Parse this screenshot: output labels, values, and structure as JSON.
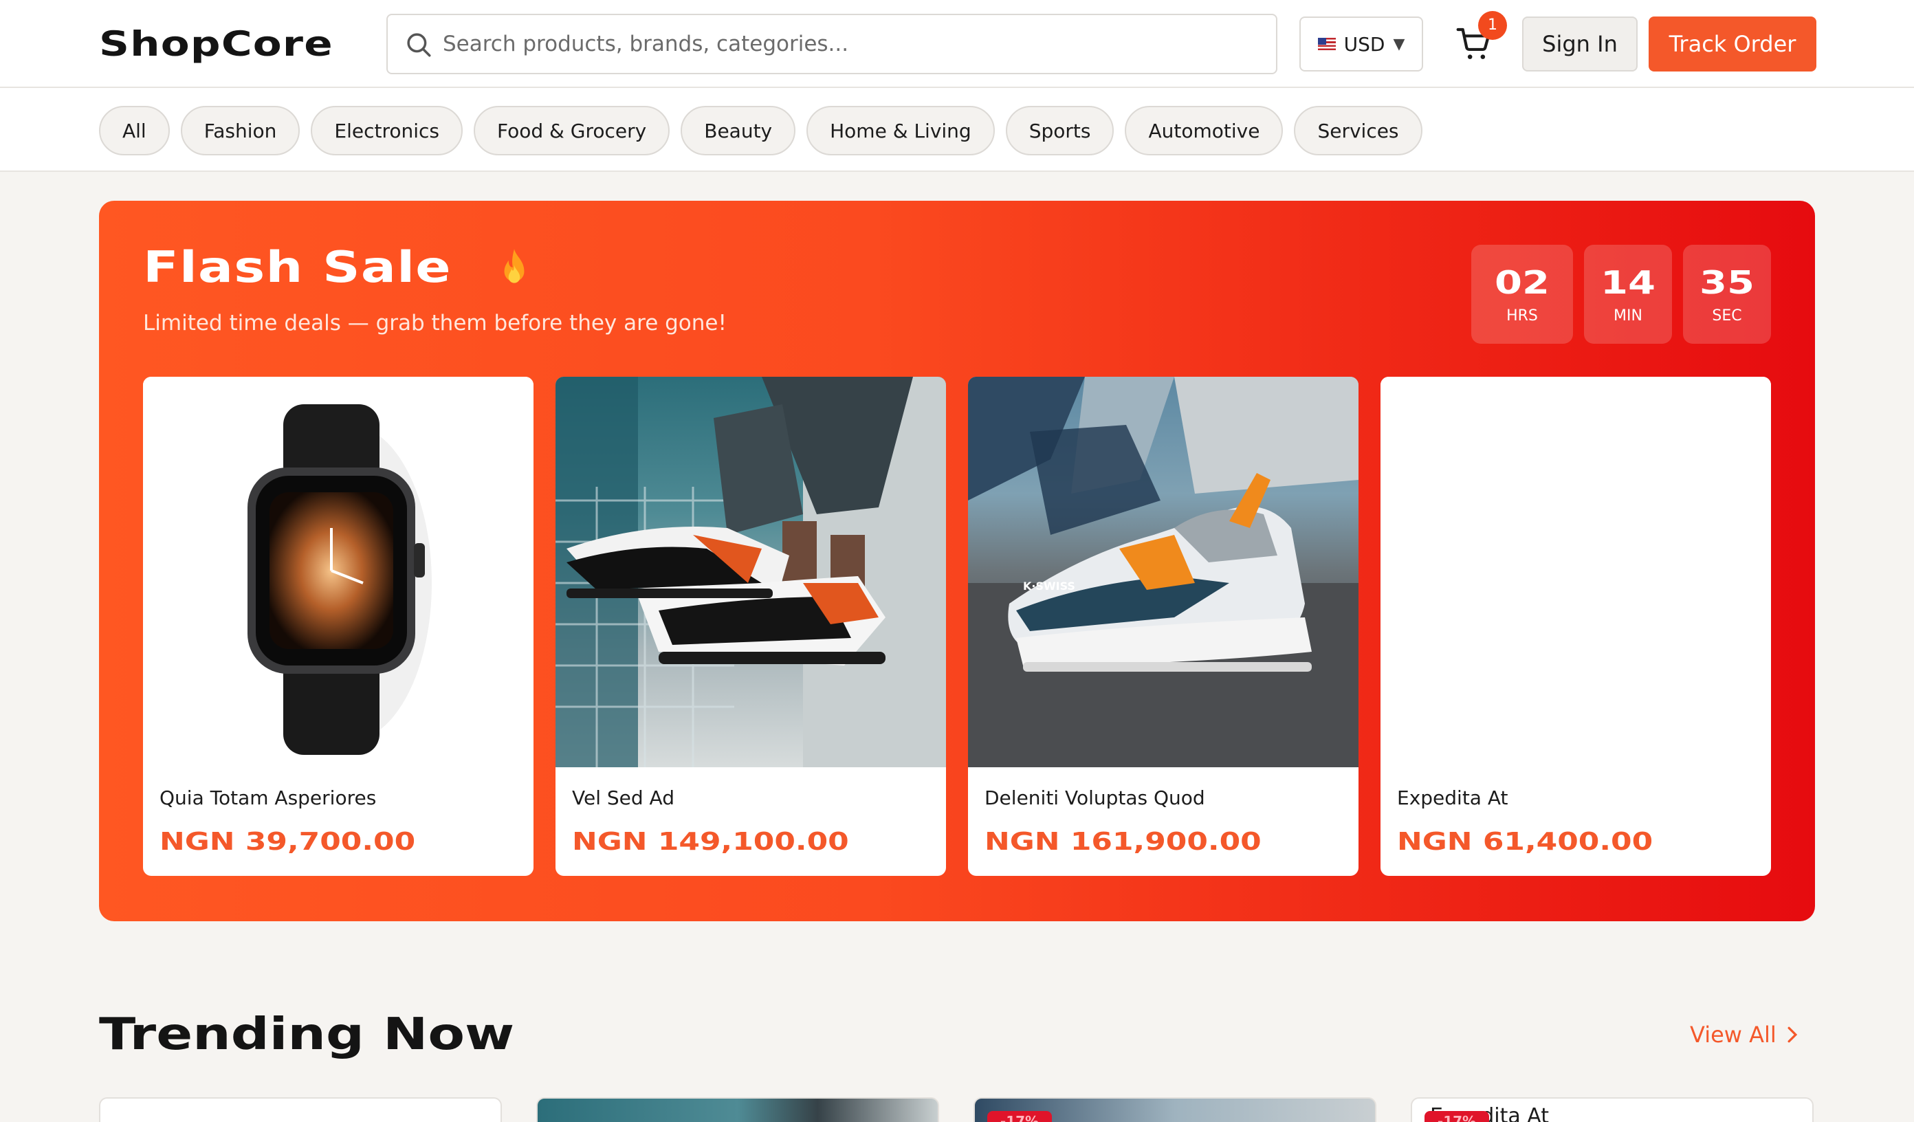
{
  "header": {
    "logo": "ShopCore",
    "search_placeholder": "Search products, brands, categories...",
    "currency": "USD",
    "currency_flag": "us-flag-icon",
    "cart_count": "1",
    "sign_in": "Sign In",
    "track_order": "Track Order"
  },
  "categories": [
    "All",
    "Fashion",
    "Electronics",
    "Food & Grocery",
    "Beauty",
    "Home & Living",
    "Sports",
    "Automotive",
    "Services"
  ],
  "flash_sale": {
    "title": "Flash Sale",
    "subtitle": "Limited time deals — grab them before they are gone!",
    "timer": [
      {
        "value": "02",
        "label": "HRS"
      },
      {
        "value": "14",
        "label": "MIN"
      },
      {
        "value": "35",
        "label": "SEC"
      }
    ],
    "products": [
      {
        "name": "Quia Totam Asperiores",
        "price": "NGN 39,700.00",
        "image": "smartwatch-image"
      },
      {
        "name": "Vel Sed Ad",
        "price": "NGN 149,100.00",
        "image": "sneakers-worn-image"
      },
      {
        "name": "Deleniti Voluptas Quod",
        "price": "NGN 161,900.00",
        "image": "kswiss-sneaker-image"
      },
      {
        "name": "Expedita At",
        "price": "NGN 61,400.00",
        "image": ""
      }
    ]
  },
  "trending": {
    "title": "Trending Now",
    "view_all": "View All",
    "cards": [
      {
        "badge": "",
        "name": ""
      },
      {
        "badge": "",
        "name": ""
      },
      {
        "badge": "-17%",
        "name": ""
      },
      {
        "badge": "-17%",
        "name": "Expedita At"
      }
    ]
  },
  "colors": {
    "accent": "#f4582a",
    "flash_gradient_start": "#ff5722",
    "flash_gradient_end": "#e60b0f",
    "badge": "#e0142a"
  }
}
